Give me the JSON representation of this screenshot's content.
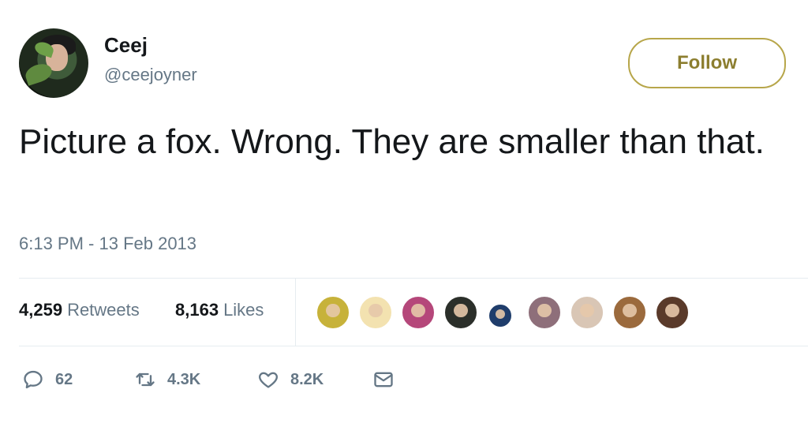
{
  "user": {
    "display_name": "Ceej",
    "handle": "@ceejoyner"
  },
  "follow_label": "Follow",
  "tweet": {
    "text": "Picture a fox. Wrong. They are smaller than that.",
    "timestamp": "6:13 PM - 13 Feb 2013"
  },
  "stats": {
    "retweets_count": "4,259",
    "retweets_label": "Retweets",
    "likes_count": "8,163",
    "likes_label": "Likes"
  },
  "liker_avatars": [
    {
      "icon": "liker-avatar",
      "color": "#c7b23a"
    },
    {
      "icon": "liker-avatar",
      "color": "#f3e2b0"
    },
    {
      "icon": "liker-avatar",
      "color": "#b5477a"
    },
    {
      "icon": "liker-avatar",
      "color": "#2b2f2a"
    },
    {
      "icon": "liker-avatar",
      "color": "#1f3d6b"
    },
    {
      "icon": "liker-avatar",
      "color": "#8e6f7a"
    },
    {
      "icon": "liker-avatar",
      "color": "#d9c6b5"
    },
    {
      "icon": "liker-avatar",
      "color": "#9b6a3d"
    },
    {
      "icon": "liker-avatar",
      "color": "#5a3a2a"
    }
  ],
  "actions": {
    "reply_count": "62",
    "retweet_count": "4.3K",
    "like_count": "8.2K"
  },
  "colors": {
    "follow_border": "#b7a64a",
    "follow_text": "#8c7e2f",
    "secondary_text": "#657786",
    "divider": "#e6ecf0"
  }
}
